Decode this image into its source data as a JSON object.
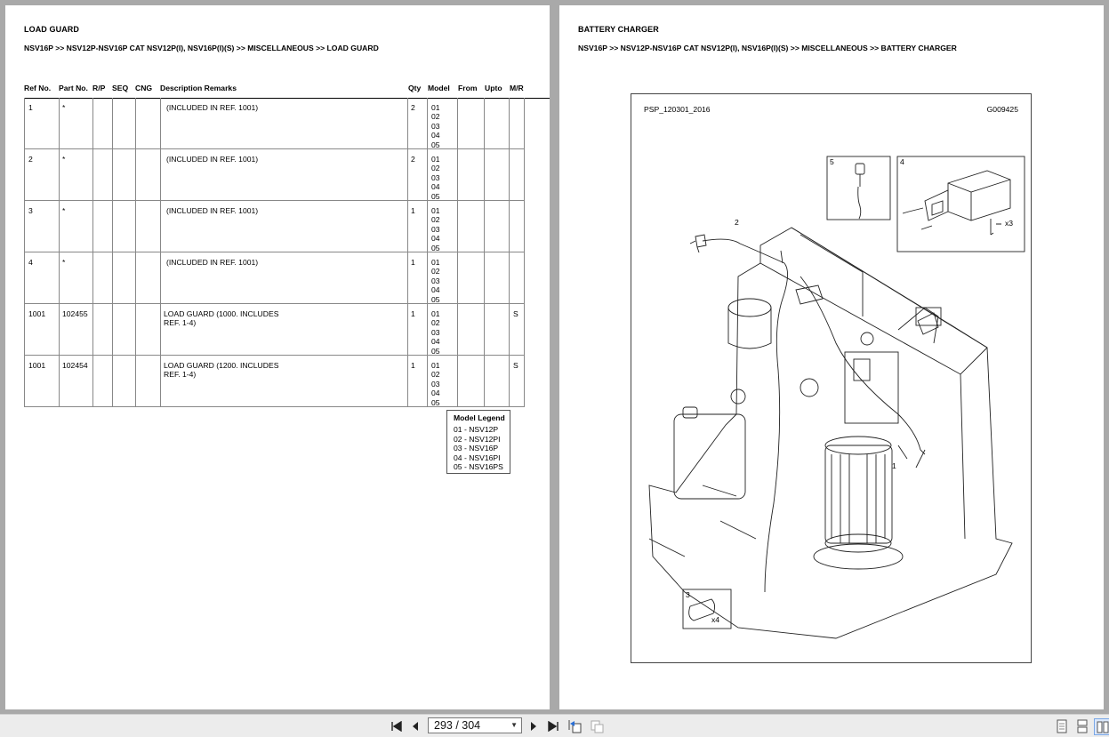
{
  "left_page": {
    "title": "LOAD GUARD",
    "breadcrumb": "NSV16P >> NSV12P-NSV16P CAT NSV12P(I), NSV16P(I)(S) >> MISCELLANEOUS >> LOAD GUARD",
    "columns": [
      "Ref No.",
      "Part No.",
      "R/P",
      "SEQ",
      "CNG",
      "Description Remarks",
      "Qty",
      "Model",
      "From",
      "Upto",
      "M/R"
    ],
    "rows": [
      {
        "ref": "1",
        "part": "*",
        "desc1": "(INCLUDED IN REF. 1001)",
        "desc2": "",
        "qty": "2",
        "models": [
          "01",
          "02",
          "03",
          "04",
          "05"
        ],
        "mr": ""
      },
      {
        "ref": "2",
        "part": "*",
        "desc1": "(INCLUDED IN REF. 1001)",
        "desc2": "",
        "qty": "2",
        "models": [
          "01",
          "02",
          "03",
          "04",
          "05"
        ],
        "mr": ""
      },
      {
        "ref": "3",
        "part": "*",
        "desc1": "(INCLUDED IN REF. 1001)",
        "desc2": "",
        "qty": "1",
        "models": [
          "01",
          "02",
          "03",
          "04",
          "05"
        ],
        "mr": ""
      },
      {
        "ref": "4",
        "part": "*",
        "desc1": "(INCLUDED IN REF. 1001)",
        "desc2": "",
        "qty": "1",
        "models": [
          "01",
          "02",
          "03",
          "04",
          "05"
        ],
        "mr": ""
      },
      {
        "ref": "1001",
        "part": "102455",
        "desc1": "LOAD GUARD (1000. INCLUDES",
        "desc2": "REF. 1-4)",
        "qty": "1",
        "models": [
          "01",
          "02",
          "03",
          "04",
          "05"
        ],
        "mr": "S"
      },
      {
        "ref": "1001",
        "part": "102454",
        "desc1": "LOAD GUARD (1200. INCLUDES",
        "desc2": "REF. 1-4)",
        "qty": "1",
        "models": [
          "01",
          "02",
          "03",
          "04",
          "05"
        ],
        "mr": "S"
      }
    ],
    "legend": {
      "title": "Model Legend",
      "items": [
        "01 - NSV12P",
        "02 - NSV12PI",
        "03 - NSV16P",
        "04 - NSV16PI",
        "05 - NSV16PS"
      ]
    }
  },
  "right_page": {
    "title": "BATTERY CHARGER",
    "breadcrumb": "NSV16P >> NSV12P-NSV16P CAT NSV12P(I), NSV16P(I)(S) >> MISCELLANEOUS >> BATTERY CHARGER",
    "figure": {
      "code_left": "PSP_120301_2016",
      "code_right": "G009425",
      "callouts": [
        "1",
        "2",
        "3",
        "4",
        "5"
      ],
      "qty_marks": [
        "x3",
        "x4"
      ]
    }
  },
  "toolbar": {
    "page_indicator": "293 / 304",
    "icons": [
      "first-page-icon",
      "prev-page-icon",
      "next-page-icon",
      "last-page-icon",
      "back-view-icon",
      "forward-view-icon",
      "single-page-view-icon",
      "continuous-view-icon",
      "two-page-view-icon"
    ]
  }
}
